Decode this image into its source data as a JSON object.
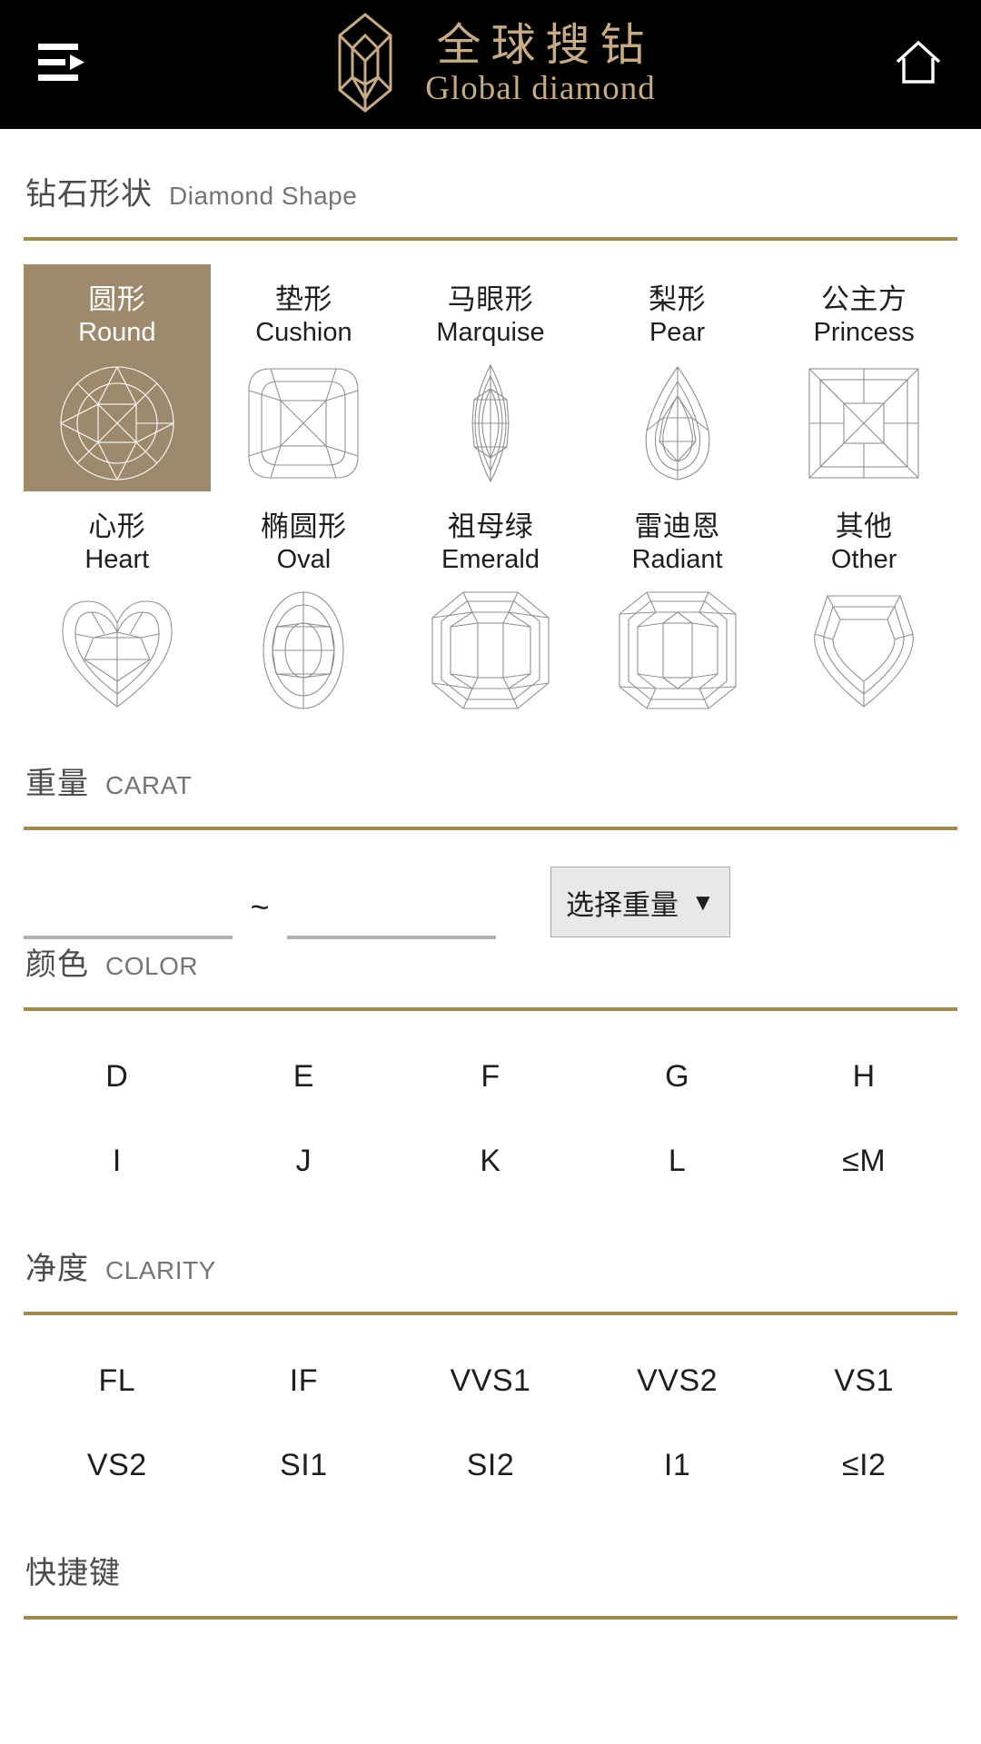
{
  "header": {
    "menu_icon": "hamburger-arrow-icon",
    "home_icon": "home-icon",
    "brand_cn": "全球搜钻",
    "brand_en": "Global diamond",
    "brand_color": "#c7ab86",
    "background": "#000000"
  },
  "theme": {
    "accent_rule": "#a08a4f",
    "selected_bg": "#9d8a6d",
    "selected_fg": "#ffffff",
    "text": "#1e1e1e",
    "muted_text": "#757575"
  },
  "shape_section": {
    "title_cn": "钻石形状",
    "title_en": "Diamond Shape",
    "shapes": [
      {
        "cn": "圆形",
        "en": "Round",
        "art": "round",
        "selected": true
      },
      {
        "cn": "垫形",
        "en": "Cushion",
        "art": "cushion",
        "selected": false
      },
      {
        "cn": "马眼形",
        "en": "Marquise",
        "art": "marquise",
        "selected": false
      },
      {
        "cn": "梨形",
        "en": "Pear",
        "art": "pear",
        "selected": false
      },
      {
        "cn": "公主方",
        "en": "Princess",
        "art": "princess",
        "selected": false
      },
      {
        "cn": "心形",
        "en": "Heart",
        "art": "heart",
        "selected": false
      },
      {
        "cn": "椭圆形",
        "en": "Oval",
        "art": "oval",
        "selected": false
      },
      {
        "cn": "祖母绿",
        "en": "Emerald",
        "art": "emerald",
        "selected": false
      },
      {
        "cn": "雷迪恩",
        "en": "Radiant",
        "art": "radiant",
        "selected": false
      },
      {
        "cn": "其他",
        "en": "Other",
        "art": "other",
        "selected": false
      }
    ]
  },
  "carat_section": {
    "title_cn": "重量",
    "title_en": "CARAT",
    "min_value": "",
    "min_placeholder": "",
    "separator": "~",
    "max_value": "",
    "max_placeholder": "",
    "select_label": "选择重量",
    "select_caret": "▼"
  },
  "color_section": {
    "title_cn": "颜色",
    "title_en": "COLOR",
    "grades": [
      "D",
      "E",
      "F",
      "G",
      "H",
      "I",
      "J",
      "K",
      "L",
      "≤M"
    ]
  },
  "clarity_section": {
    "title_cn": "净度",
    "title_en": "CLARITY",
    "grades": [
      "FL",
      "IF",
      "VVS1",
      "VVS2",
      "VS1",
      "VS2",
      "SI1",
      "SI2",
      "I1",
      "≤I2"
    ]
  },
  "shortcut_section": {
    "title_cn": "快捷键",
    "title_en": ""
  }
}
